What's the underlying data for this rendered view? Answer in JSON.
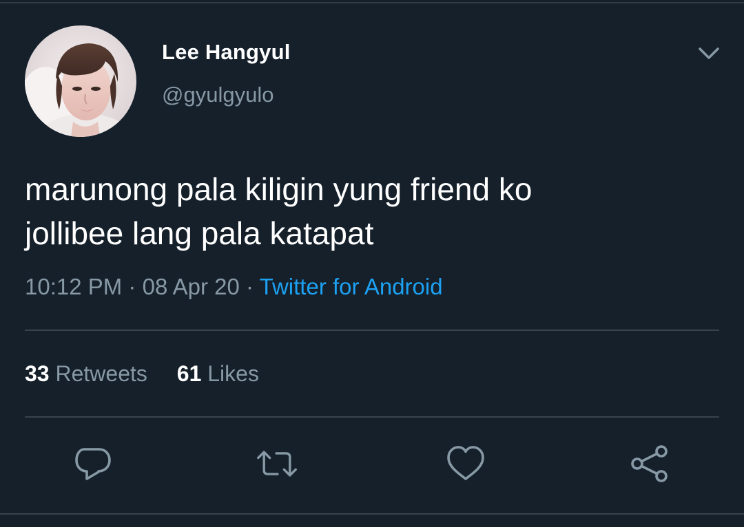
{
  "tweet": {
    "display_name": "Lee Hangyul",
    "handle": "@gyulgyulo",
    "text_lines": [
      "marunong pala kiligin yung friend ko",
      "jollibee lang pala katapat"
    ],
    "time": "10:12 PM",
    "separator": "·",
    "date": "08 Apr 20",
    "source": "Twitter for Android",
    "retweets_count": "33",
    "retweets_label": "Retweets",
    "likes_count": "61",
    "likes_label": "Likes"
  },
  "icons": {
    "menu": "chevron-down-icon",
    "reply": "reply-icon",
    "retweet": "retweet-icon",
    "like": "heart-icon",
    "share": "share-icon"
  },
  "colors": {
    "background": "#15202b",
    "primary_text": "#ffffff",
    "secondary_text": "#8899a6",
    "link": "#1da1f2",
    "divider": "#38444d"
  }
}
